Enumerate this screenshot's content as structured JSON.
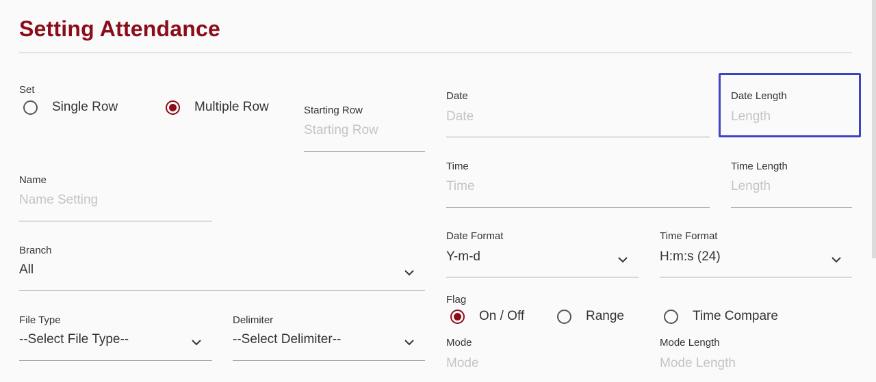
{
  "page": {
    "title": "Setting Attendance"
  },
  "set": {
    "label": "Set",
    "options": [
      "Single Row",
      "Multiple Row"
    ],
    "selected": "Multiple Row"
  },
  "starting_row": {
    "label": "Starting Row",
    "placeholder": "Starting Row",
    "value": ""
  },
  "name": {
    "label": "Name",
    "placeholder": "Name Setting",
    "value": ""
  },
  "branch": {
    "label": "Branch",
    "value": "All",
    "icon": "chevron-down-icon"
  },
  "file_type": {
    "label": "File Type",
    "value": "--Select File Type--",
    "icon": "chevron-down-icon"
  },
  "delimiter": {
    "label": "Delimiter",
    "value": "--Select Delimiter--",
    "icon": "chevron-down-icon"
  },
  "date": {
    "label": "Date",
    "placeholder": "Date",
    "value": ""
  },
  "date_length": {
    "label": "Date Length",
    "placeholder": "Length",
    "value": "",
    "focused": true
  },
  "time": {
    "label": "Time",
    "placeholder": "Time",
    "value": ""
  },
  "time_length": {
    "label": "Time Length",
    "placeholder": "Length",
    "value": ""
  },
  "date_format": {
    "label": "Date Format",
    "value": "Y-m-d",
    "icon": "chevron-down-icon"
  },
  "time_format": {
    "label": "Time Format",
    "value": "H:m:s (24)",
    "icon": "chevron-down-icon"
  },
  "flag": {
    "label": "Flag",
    "options": [
      "On / Off",
      "Range",
      "Time Compare"
    ],
    "selected": "On / Off"
  },
  "mode": {
    "label": "Mode",
    "placeholder": "Mode",
    "value": ""
  },
  "mode_length": {
    "label": "Mode Length",
    "placeholder": "Mode Length",
    "value": ""
  },
  "colors": {
    "accent": "#8b0d1a",
    "focus": "#3c43c4",
    "placeholder": "#c4c4c4",
    "underline": "#a8a8a8"
  }
}
